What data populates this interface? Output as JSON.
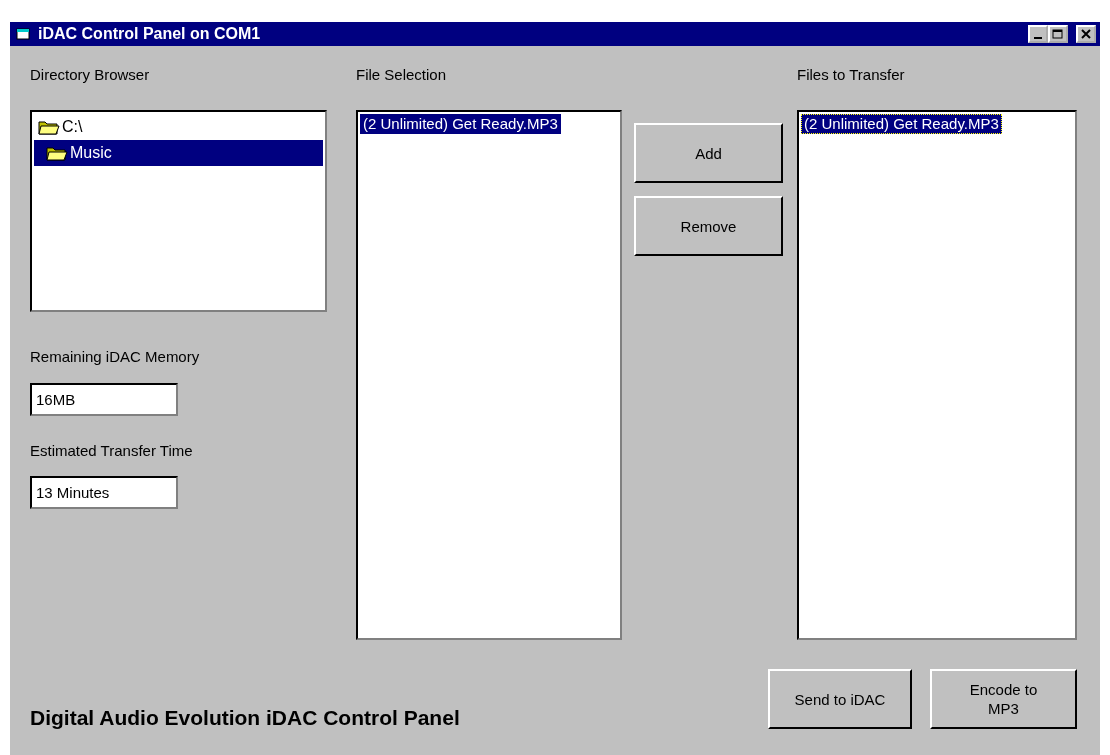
{
  "window": {
    "title": "iDAC Control Panel on COM1"
  },
  "directory_browser": {
    "label": "Directory Browser",
    "items": [
      {
        "name": "C:\\",
        "selected": false,
        "children": [
          {
            "name": "Music",
            "selected": true
          }
        ]
      }
    ]
  },
  "remaining_memory": {
    "label": "Remaining iDAC Memory",
    "value": "16MB"
  },
  "transfer_time": {
    "label": "Estimated Transfer Time",
    "value": "13 Minutes"
  },
  "file_selection": {
    "label": "File Selection",
    "items": [
      {
        "name": "(2 Unlimited) Get Ready.MP3",
        "selected": true,
        "focused": false
      }
    ]
  },
  "action_buttons": [
    "Add",
    "Remove"
  ],
  "files_to_transfer": {
    "label": "Files to Transfer",
    "items": [
      {
        "name": "(2 Unlimited) Get Ready.MP3",
        "selected": true,
        "focused": true
      }
    ]
  },
  "footer_title": "Digital Audio Evolution iDAC Control Panel",
  "footer_buttons": [
    "Send to iDAC",
    "Encode to MP3"
  ]
}
